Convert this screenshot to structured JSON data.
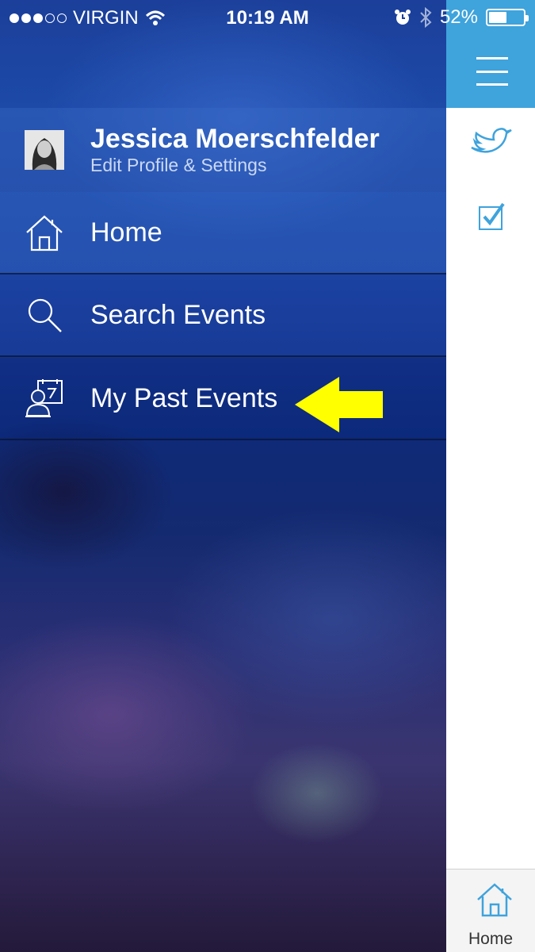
{
  "status_bar": {
    "carrier": "VIRGIN",
    "time": "10:19 AM",
    "battery": "52%",
    "signal_bars_filled": 3,
    "signal_bars_total": 5,
    "battery_level": 0.52
  },
  "profile": {
    "name": "Jessica Moerschfelder",
    "subtitle": "Edit Profile & Settings"
  },
  "menu": {
    "items": [
      {
        "label": "Home",
        "icon": "home-icon"
      },
      {
        "label": "Search Events",
        "icon": "search-icon"
      },
      {
        "label": "My Past Events",
        "icon": "past-events-icon"
      }
    ]
  },
  "annotation": {
    "arrow": "yellow-arrow",
    "color": "#ffff00"
  },
  "right_panel": {
    "accent_color": "#3fa3dc",
    "icons": [
      "menu-icon",
      "twitter-icon",
      "checkbox-icon"
    ],
    "tab": {
      "label": "Home",
      "icon": "home-icon"
    }
  }
}
